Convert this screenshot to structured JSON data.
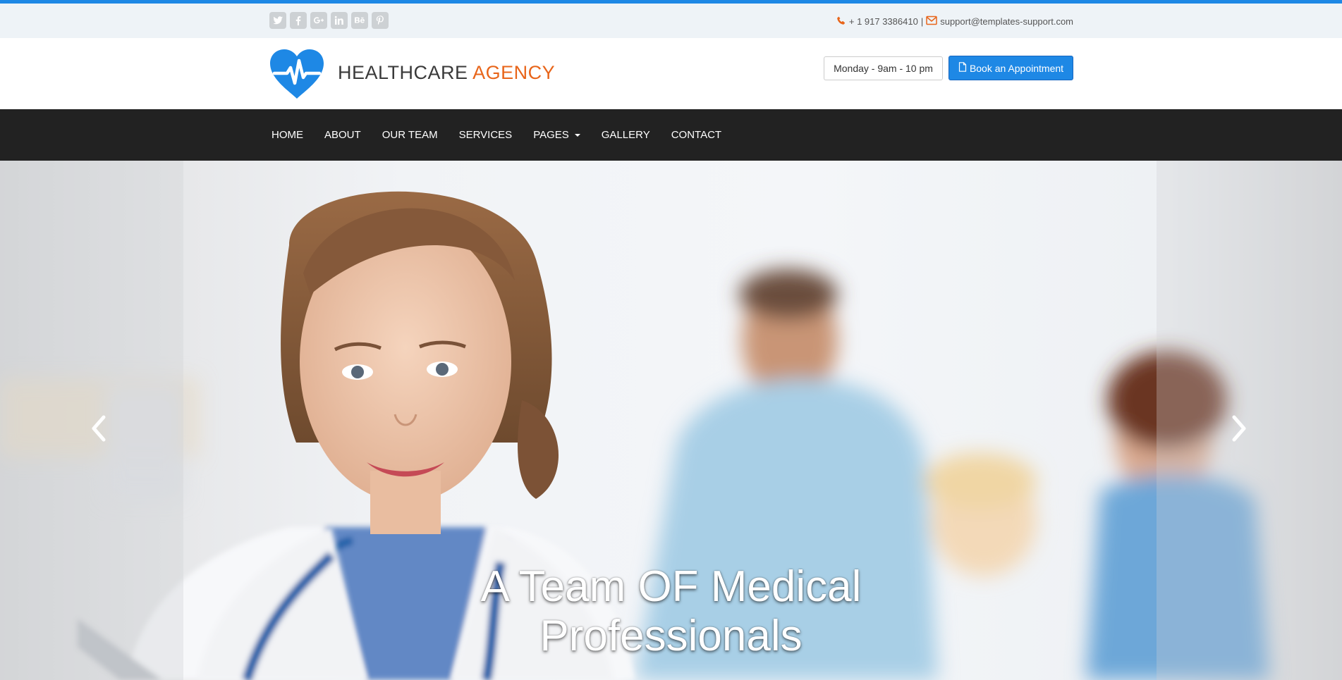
{
  "colors": {
    "accent": "#1e88e5",
    "brand_orange": "#e8651a",
    "navbar_bg": "#222222",
    "topbar_bg": "#eef3f7",
    "social_icon_bg": "#cdd1d4"
  },
  "topbar": {
    "social_icons": [
      "twitter-icon",
      "facebook-icon",
      "google-plus-icon",
      "linkedin-icon",
      "behance-icon",
      "pinterest-icon"
    ],
    "phone": "+ 1 917 3386410",
    "separator": "|",
    "email": "support@templates-support.com"
  },
  "header": {
    "brand_part1": "HEALTHCARE",
    "brand_part2": "AGENCY",
    "hours": "Monday - 9am - 10 pm",
    "book_label": "Book an Appointment"
  },
  "nav": {
    "items": [
      "HOME",
      "ABOUT",
      "OUR TEAM",
      "SERVICES",
      "PAGES",
      "GALLERY",
      "CONTACT"
    ]
  },
  "hero": {
    "caption_line1": "A Team OF Medical",
    "caption_line2": "Professionals"
  }
}
